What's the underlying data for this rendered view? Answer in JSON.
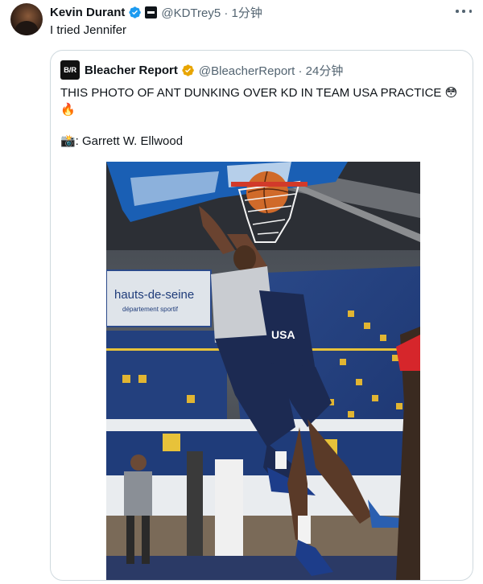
{
  "tweet": {
    "author_name": "Kevin Durant",
    "handle_time": "@KDTrey5 · 1分钟",
    "text": "I tried Jennifer"
  },
  "quote": {
    "author_name": "Bleacher Report",
    "logo_text": "B/R",
    "handle_time": "@BleacherReport · 24分钟",
    "text_line1": "THIS PHOTO OF ANT DUNKING OVER KD IN TEAM USA PRACTICE 😳",
    "text_line2": "🔥",
    "credit": "📸: Garrett W. Ellwood",
    "photo": {
      "banner_text": "hauts-de-seine",
      "banner_subtext": "département sportif",
      "jersey_text": "USA"
    }
  },
  "colors": {
    "verified_blue": "#1d9bf0",
    "verified_gold": "#e8a500",
    "secondary_text": "#536471",
    "border": "#cfd9de"
  },
  "icons": [
    "verified-badge-icon",
    "affiliate-badge-icon",
    "more-options-icon",
    "verified-gold-badge-icon"
  ]
}
